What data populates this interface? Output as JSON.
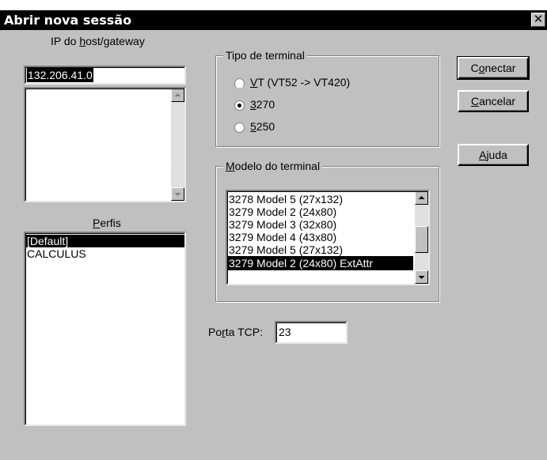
{
  "window": {
    "title": "Abrir nova sessão",
    "close_glyph": "✕"
  },
  "host": {
    "label_before": "IP do ",
    "label_underlined": "h",
    "label_after": "ost/gateway",
    "value": "132.206.41.0"
  },
  "profiles": {
    "label_underlined": "P",
    "label_after": "erfis",
    "items": [
      "[Default]",
      "CALCULUS"
    ],
    "selected_index": 0
  },
  "terminal_type": {
    "legend": "Tipo de terminal",
    "options": [
      {
        "underlined": "V",
        "rest": "T (VT52 -> VT420)",
        "checked": false
      },
      {
        "underlined": "3",
        "rest": "270",
        "checked": true
      },
      {
        "underlined": "5",
        "rest": "250",
        "checked": false
      }
    ]
  },
  "terminal_model": {
    "legend_underlined": "M",
    "legend_after": "odelo do terminal",
    "items": [
      "3278 Model 5 (27x132)",
      "3279 Model 2 (24x80)",
      "3279 Model 3 (32x80)",
      "3279 Model 4 (43x80)",
      "3279 Model 5 (27x132)",
      "3279 Model 2 (24x80) ExtAttr"
    ],
    "selected_index": 5
  },
  "tcp_port": {
    "label_before": "Po",
    "label_underlined": "r",
    "label_after": "ta TCP:",
    "value": "23"
  },
  "buttons": {
    "connect": {
      "before": "C",
      "underlined": "o",
      "after": "nectar"
    },
    "cancel": {
      "before": "",
      "underlined": "C",
      "after": "ancelar"
    },
    "help": {
      "before": "",
      "underlined": "A",
      "after": "juda"
    }
  },
  "icons": {
    "close": "close-icon",
    "scroll_up": "arrow-up-icon",
    "scroll_down": "arrow-down-icon",
    "radio": "radio-icon"
  },
  "colors": {
    "titlebar": "#000000",
    "dialog_bg": "#c0c0c0",
    "selection": "#000000"
  }
}
